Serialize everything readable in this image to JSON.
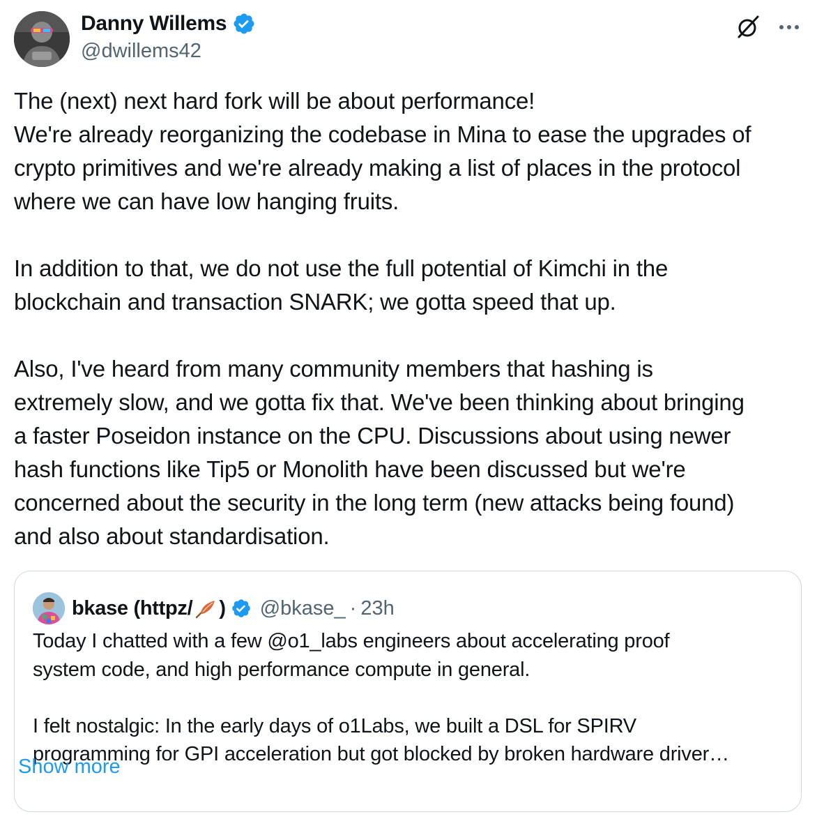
{
  "author": {
    "name": "Danny Willems",
    "handle": "@dwillems42",
    "verified": true
  },
  "icons": {
    "verified": "verified-badge-icon",
    "grok": "grok-icon",
    "more": "more-options-icon",
    "feather": "feather-emoji-icon"
  },
  "colors": {
    "verified_blue": "#1d9bf0",
    "secondary_text": "#536471",
    "link": "#1d9bf0",
    "border": "#cfd9de"
  },
  "tweet": {
    "lines": [
      "The (next) next hard fork will be about performance!",
      "We're already reorganizing the codebase in Mina to ease the upgrades of",
      "crypto primitives and we're already making a list of places in the protocol",
      "where we can have low hanging fruits.",
      "",
      "In addition to that, we do not use the full potential of Kimchi in the",
      "blockchain and transaction SNARK; we gotta speed that up.",
      "",
      "Also, I've heard from many community members that hashing is",
      "extremely slow, and we gotta fix that. We've been thinking about bringing",
      "a faster Poseidon instance on the CPU. Discussions about using newer",
      "hash functions like Tip5 or Monolith have been discussed but we're",
      "concerned about the security in the long term (new attacks being found)",
      "and also about standardisation."
    ]
  },
  "quote": {
    "name_prefix": "bkase (httpz/",
    "name_suffix": ")",
    "handle": "@bkase_",
    "separator": "·",
    "time": "23h",
    "verified": true,
    "lines": [
      "Today I chatted with a few @o1_labs engineers about accelerating proof",
      "system code, and high performance compute in general.",
      "",
      "I felt nostalgic: In the early days of o1Labs, we built a DSL for SPIRV",
      "programming for GPI acceleration but got blocked by broken hardware driver…"
    ],
    "show_more": "Show more"
  }
}
